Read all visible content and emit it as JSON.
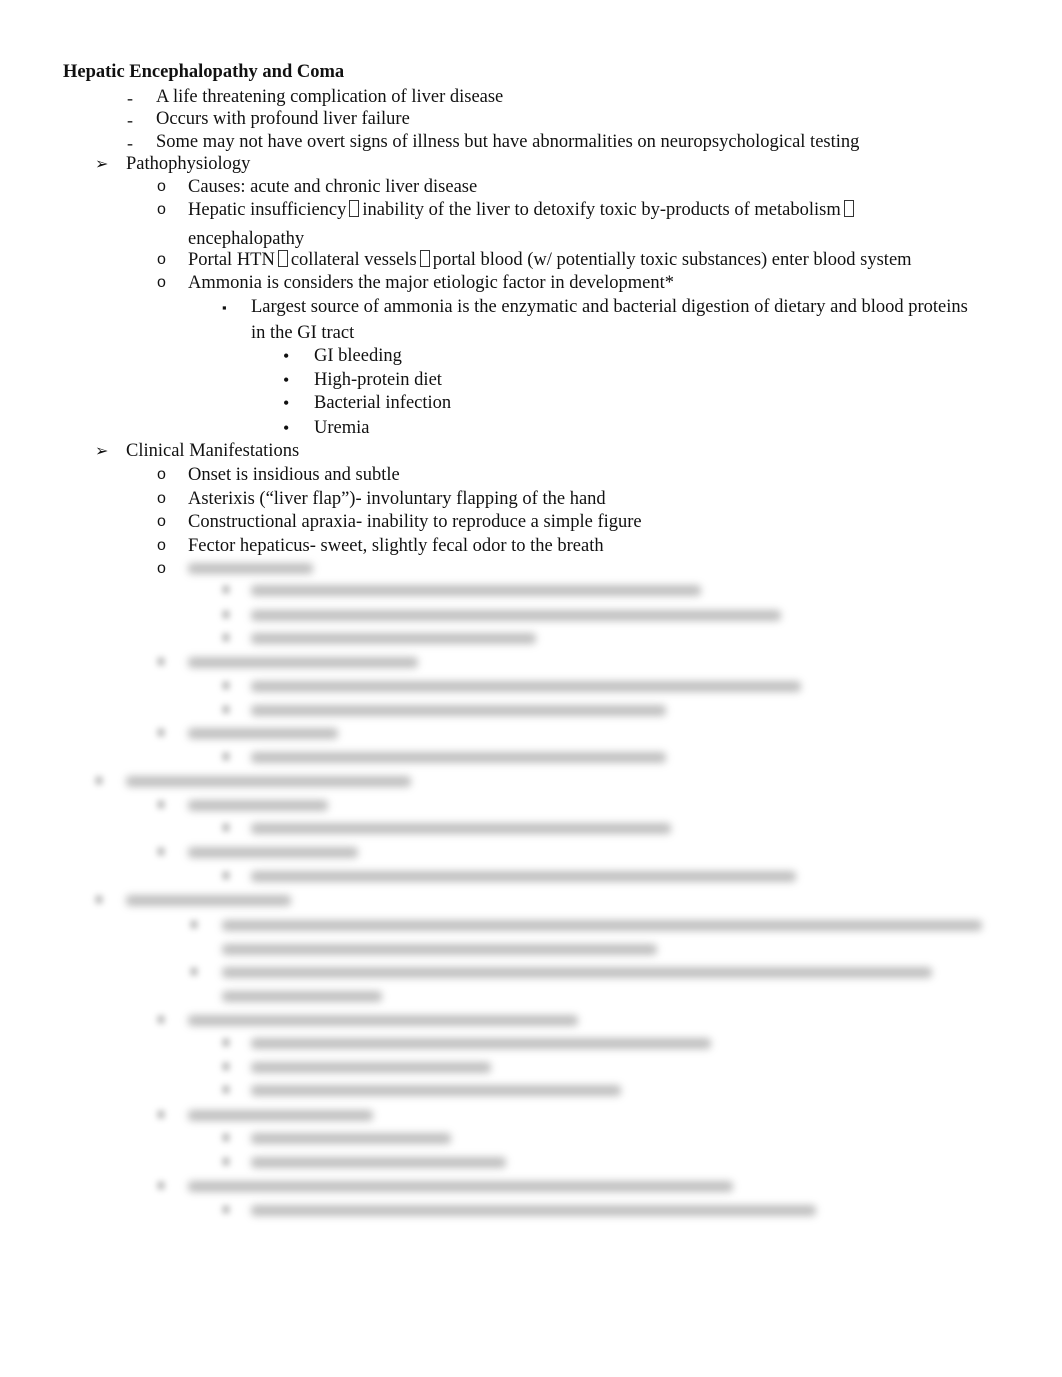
{
  "document": {
    "title": "Hepatic Encephalopathy and Coma",
    "intro": [
      "A life threatening complication of liver disease",
      "Occurs with profound liver failure",
      "Some may not have overt signs of illness but have abnormalities on neuropsychological testing"
    ],
    "sections": [
      {
        "heading": "Pathophysiology",
        "items": [
          {
            "text": "Causes: acute and chronic liver disease"
          },
          {
            "text_parts": [
              "Hepatic insufficiency",
              "inability of the liver to detoxify toxic by-products of metabolism",
              "encephalopathy"
            ]
          },
          {
            "text_parts": [
              "Portal HTN",
              "collateral vessels",
              "portal blood (w/ potentially toxic substances) enter blood system"
            ]
          },
          {
            "text": "Ammonia is considers the major etiologic factor in development*",
            "sub": {
              "line1": "Largest source of ammonia is the enzymatic and bacterial digestion of dietary and blood proteins",
              "line2": "in the GI tract",
              "bullets": [
                "GI bleeding",
                "High-protein diet",
                "Bacterial infection",
                "Uremia"
              ]
            }
          }
        ]
      },
      {
        "heading": "Clinical Manifestations",
        "items": [
          {
            "text": "Onset is insidious and subtle"
          },
          {
            "text": "Asterixis (“liver flap”)- involuntary flapping of the hand"
          },
          {
            "text": "Constructional apraxia- inability to reproduce a simple figure"
          },
          {
            "text": "Fector hepaticus- sweet, slightly fecal odor to the breath"
          }
        ]
      }
    ],
    "markers": {
      "dash": "-",
      "arrow": "➢",
      "circle": "o",
      "square": "▪",
      "dot": "•"
    },
    "blurred_content_notice": "remaining content obscured"
  }
}
